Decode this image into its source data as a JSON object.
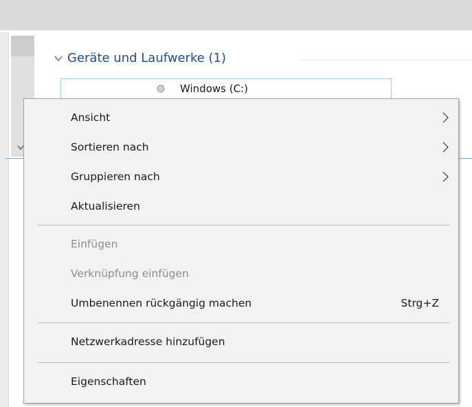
{
  "explorer": {
    "group_header": "Geräte und Laufwerke (1)",
    "drive_label": "Windows (C:)"
  },
  "context_menu": {
    "items": [
      {
        "label": "Ansicht",
        "submenu": true,
        "enabled": true
      },
      {
        "label": "Sortieren nach",
        "submenu": true,
        "enabled": true
      },
      {
        "label": "Gruppieren nach",
        "submenu": true,
        "enabled": true
      },
      {
        "label": "Aktualisieren",
        "enabled": true
      },
      {
        "label": "Einfügen",
        "enabled": false
      },
      {
        "label": "Verknüpfung einfügen",
        "enabled": false
      },
      {
        "label": "Umbenennen rückgängig machen",
        "shortcut": "Strg+Z",
        "enabled": true
      },
      {
        "label": "Netzwerkadresse hinzufügen",
        "enabled": true
      },
      {
        "label": "Eigenschaften",
        "enabled": true
      }
    ]
  },
  "colors": {
    "group_header": "#1e4e8c",
    "menu_background": "#f2f2f2",
    "disabled_text": "#8c8c8c"
  }
}
